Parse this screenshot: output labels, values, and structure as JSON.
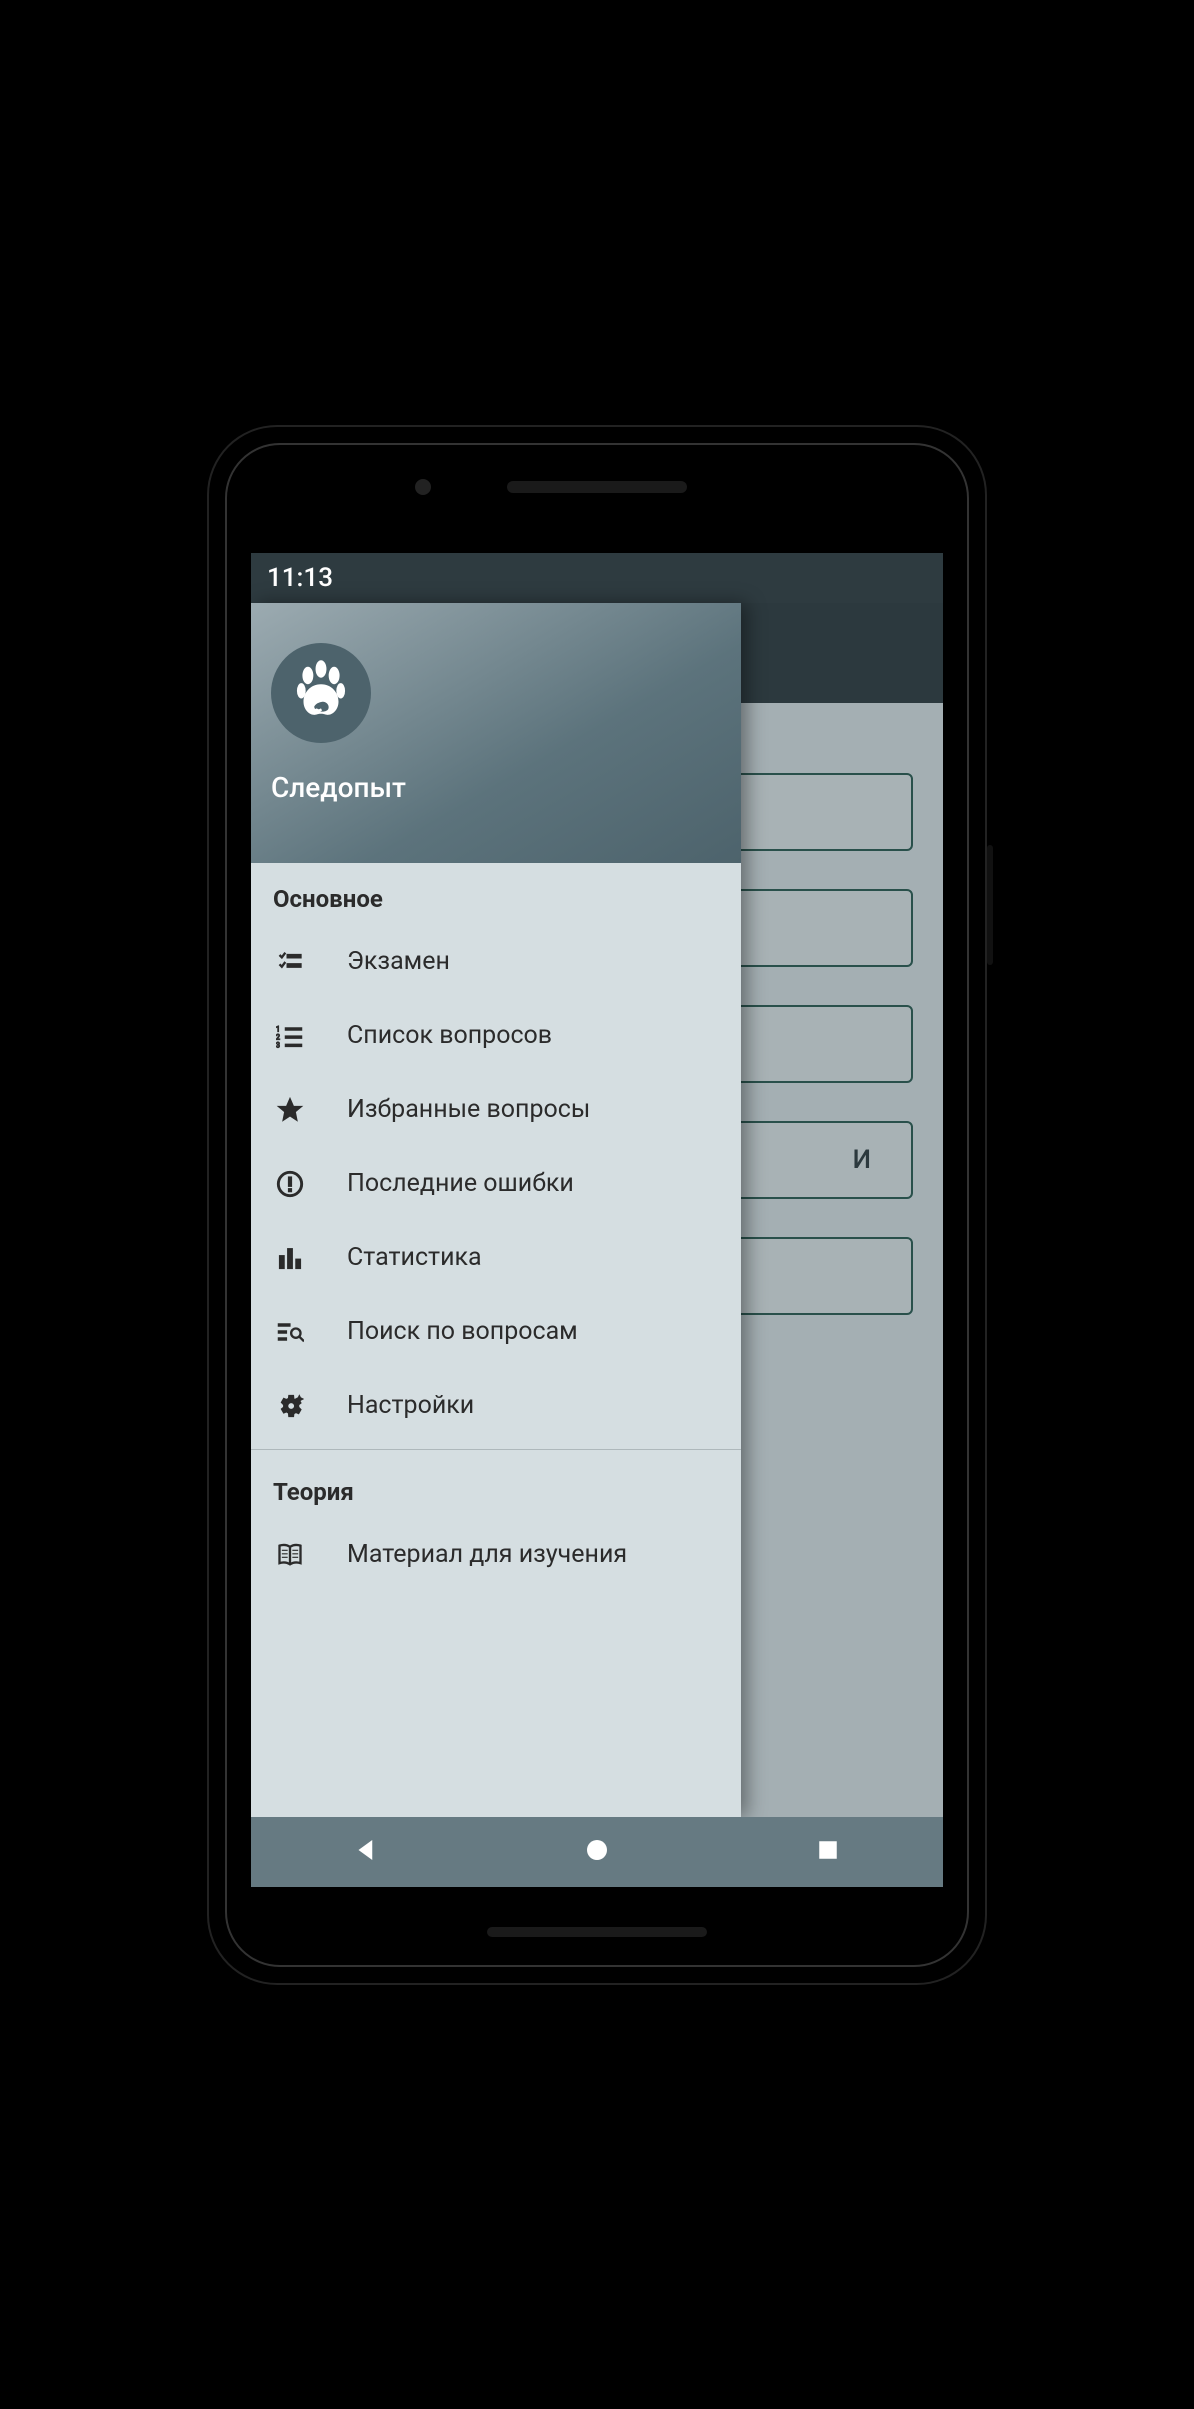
{
  "status": {
    "time": "11:13"
  },
  "drawer": {
    "app_title": "Следопыт",
    "sections": [
      {
        "title": "Основное",
        "items": [
          {
            "label": "Экзамен",
            "icon": "checklist-icon"
          },
          {
            "label": "Список вопросов",
            "icon": "numbered-list-icon"
          },
          {
            "label": "Избранные вопросы",
            "icon": "star-icon"
          },
          {
            "label": "Последние ошибки",
            "icon": "error-icon"
          },
          {
            "label": "Статистика",
            "icon": "bar-chart-icon"
          },
          {
            "label": "Поиск по вопросам",
            "icon": "search-list-icon"
          },
          {
            "label": "Настройки",
            "icon": "gear-sparkle-icon"
          }
        ]
      },
      {
        "title": "Теория",
        "items": [
          {
            "label": "Материал для изучения",
            "icon": "book-icon"
          }
        ]
      }
    ]
  },
  "behind": {
    "visible_text": "И"
  }
}
